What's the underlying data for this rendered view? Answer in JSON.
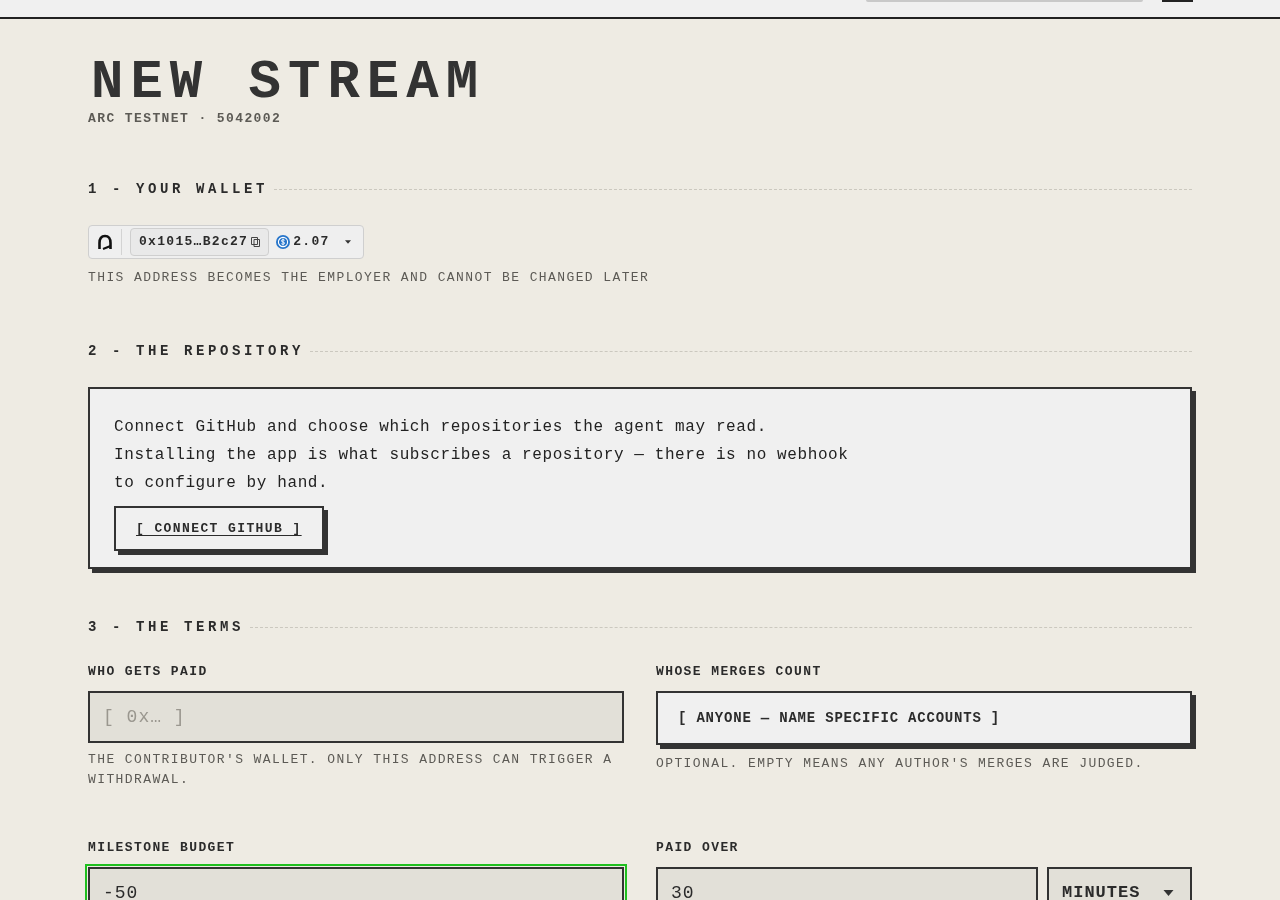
{
  "page": {
    "title": "NEW STREAM",
    "subtitle": "ARC TESTNET · 5042002"
  },
  "sections": [
    {
      "kind": "wallet",
      "heading": "1 - YOUR WALLET",
      "wallet": {
        "address": "0x1015…B2c27",
        "balance": "2.07"
      },
      "hint": "THIS ADDRESS BECOMES THE EMPLOYER AND CANNOT BE CHANGED LATER"
    },
    {
      "kind": "repository",
      "heading": "2 - THE REPOSITORY",
      "description": "Connect GitHub and choose which repositories the agent may read. Installing the app is what subscribes a repository — there is no webhook to configure by hand.",
      "button": "[ CONNECT GITHUB ]"
    },
    {
      "kind": "terms",
      "heading": "3 - THE TERMS",
      "fields": [
        {
          "kind": "input",
          "label": "WHO GETS PAID",
          "placeholder": "[ 0x… ]",
          "focused": false,
          "hint": "THE CONTRIBUTOR'S WALLET. ONLY THIS ADDRESS CAN TRIGGER A WITHDRAWAL."
        },
        {
          "kind": "button",
          "label": "WHOSE MERGES COUNT",
          "button": "[ ANYONE — NAME SPECIFIC ACCOUNTS ]",
          "hint": "OPTIONAL. EMPTY MEANS ANY AUTHOR'S MERGES ARE JUDGED."
        },
        {
          "kind": "input",
          "label": "MILESTONE BUDGET",
          "value": "-50",
          "focused": true
        },
        {
          "kind": "duration",
          "label": "PAID OVER",
          "value": "30",
          "focused": false,
          "unit": "MINUTES"
        }
      ]
    }
  ]
}
